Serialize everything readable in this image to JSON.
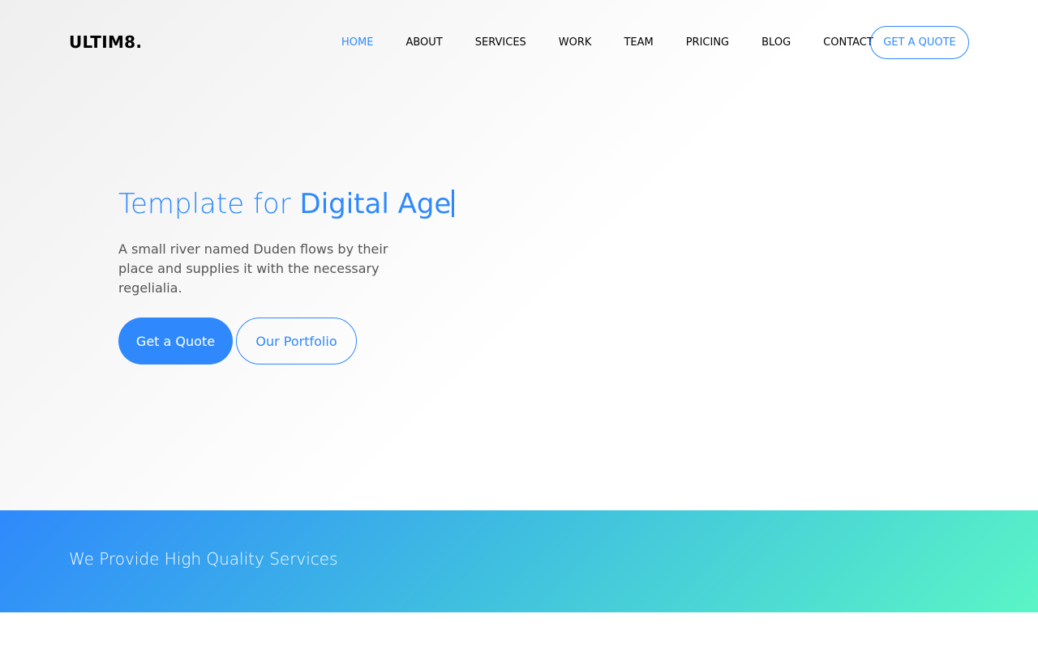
{
  "brand": "ULTIM8.",
  "nav": {
    "items": [
      {
        "label": "HOME",
        "active": true
      },
      {
        "label": "ABOUT"
      },
      {
        "label": "SERVICES"
      },
      {
        "label": "WORK"
      },
      {
        "label": "TEAM"
      },
      {
        "label": "PRICING"
      },
      {
        "label": "BLOG"
      },
      {
        "label": "CONTACT"
      }
    ],
    "cta": "GET A QUOTE"
  },
  "hero": {
    "title_prefix": "Template for ",
    "title_highlight": "Digital Age",
    "subtitle": "A small river named Duden flows by their place and supplies it with the necessary regelialia.",
    "primary_button": "Get a Quote",
    "secondary_button": "Our Portfolio"
  },
  "services": {
    "heading": "We Provide High Quality Services"
  },
  "colors": {
    "accent": "#2f89fc",
    "gradient_start": "#2f89fc",
    "gradient_end": "#5af5c6"
  }
}
